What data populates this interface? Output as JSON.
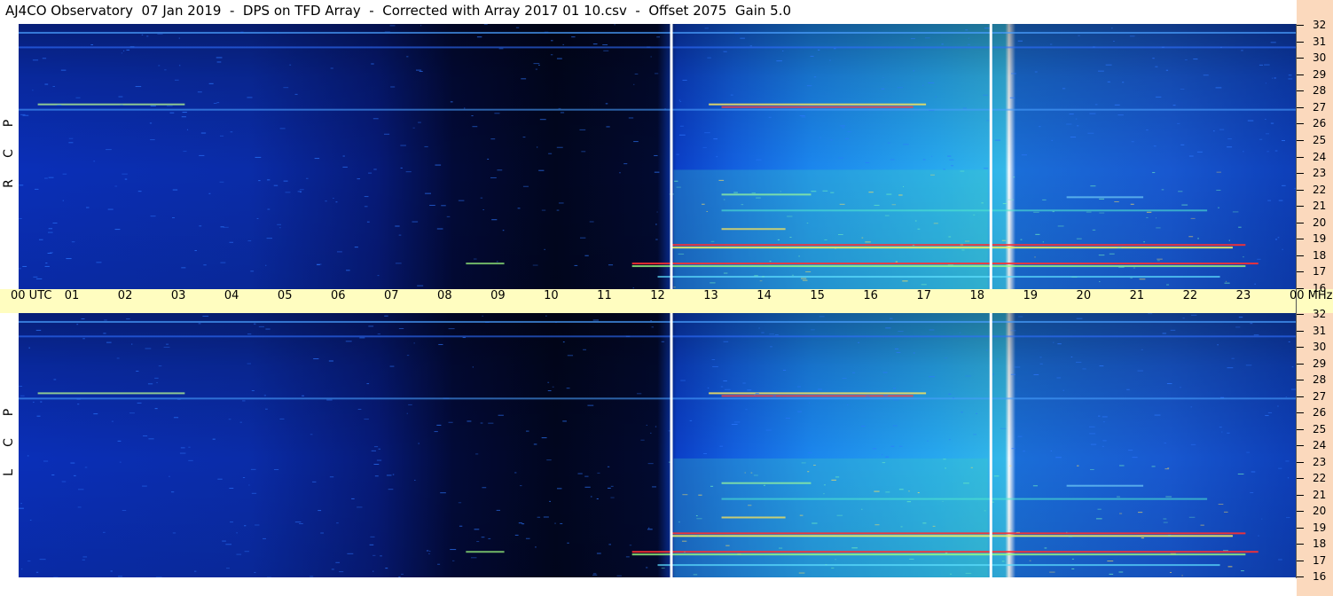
{
  "title": "AJ4CO Observatory  07 Jan 2019  -  DPS on TFD Array  -  Corrected with Array 2017 01 10.csv  -  Offset 2075  Gain 5.0",
  "chart_data": {
    "type": "heatmap",
    "x_axis": {
      "labels": [
        "00 UTC",
        "01",
        "02",
        "03",
        "04",
        "05",
        "06",
        "07",
        "08",
        "09",
        "10",
        "11",
        "12",
        "13",
        "14",
        "15",
        "16",
        "17",
        "18",
        "19",
        "20",
        "21",
        "22",
        "23",
        "00 MHz"
      ],
      "xlim_hours": [
        0,
        24
      ]
    },
    "y_axis": {
      "labels": [
        "32",
        "31",
        "30",
        "29",
        "28",
        "27",
        "26",
        "25",
        "24",
        "23",
        "22",
        "21",
        "20",
        "19",
        "18",
        "17",
        "16"
      ],
      "ylim_mhz": [
        16,
        32
      ]
    },
    "panels": [
      {
        "name": "R C P",
        "label_chars": [
          "P",
          "C",
          "R"
        ]
      },
      {
        "name": "L C P",
        "label_chars": [
          "P",
          "C",
          "L"
        ]
      }
    ],
    "colormap": [
      "#000010",
      "#00208a",
      "#1048e0",
      "#1a8cf0",
      "#30c0e8",
      "#8fe060",
      "#f0e040",
      "#ff2020",
      "#ffffff"
    ],
    "markers_hours": [
      12.25,
      18.25
    ]
  },
  "colors": {
    "time_band": "#fffdc0",
    "right_strip": "#fbd9bd"
  }
}
